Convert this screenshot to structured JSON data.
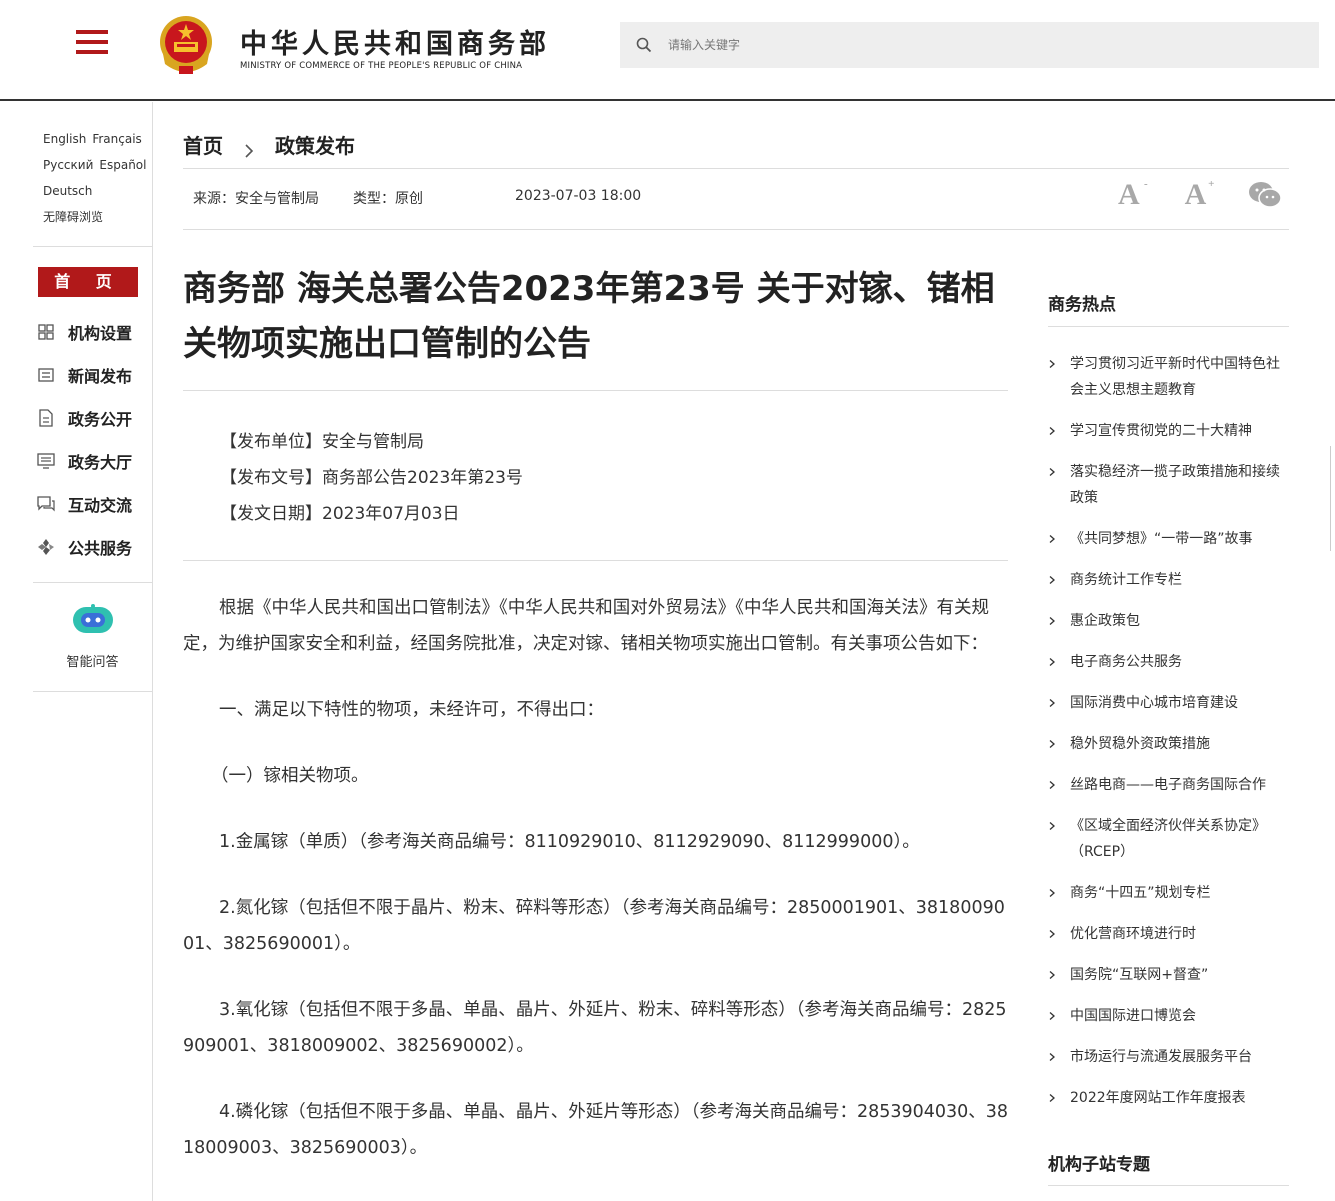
{
  "header": {
    "title": "中华人民共和国商务部",
    "subtitle": "MINISTRY OF COMMERCE OF THE PEOPLE'S REPUBLIC OF CHINA",
    "search_placeholder": "请输入关键字",
    "accent_color": "#b1191a"
  },
  "sidebar": {
    "languages": [
      [
        "English",
        "Français"
      ],
      [
        "Русский",
        "Español"
      ],
      [
        "Deutsch"
      ],
      [
        "无障碍浏览"
      ]
    ],
    "home_label": "首 页",
    "items": [
      {
        "label": "机构设置",
        "icon": "grid-icon"
      },
      {
        "label": "新闻发布",
        "icon": "news-icon"
      },
      {
        "label": "政务公开",
        "icon": "document-icon"
      },
      {
        "label": "政务大厅",
        "icon": "monitor-icon"
      },
      {
        "label": "互动交流",
        "icon": "chat-icon"
      },
      {
        "label": "公共服务",
        "icon": "service-icon"
      }
    ],
    "qa_label": "智能问答"
  },
  "breadcrumb": {
    "home": "首页",
    "current": "政策发布"
  },
  "meta": {
    "source": "来源：安全与管制局",
    "type": "类型：原创",
    "date": "2023-07-03 18:00"
  },
  "article": {
    "title": "商务部 海关总署公告2023年第23号 关于对镓、锗相关物项实施出口管制的公告",
    "issuer": "【发布单位】安全与管制局",
    "doc_no": "【发布文号】商务部公告2023年第23号",
    "doc_date": "【发文日期】2023年07月03日",
    "paragraphs": [
      "根据《中华人民共和国出口管制法》《中华人民共和国对外贸易法》《中华人民共和国海关法》有关规定，为维护国家安全和利益，经国务院批准，决定对镓、锗相关物项实施出口管制。有关事项公告如下：",
      "一、满足以下特性的物项，未经许可，不得出口：",
      "（一）镓相关物项。",
      "1.金属镓（单质）（参考海关商品编号：8110929010、8112929090、8112999000）。",
      "2.氮化镓（包括但不限于晶片、粉末、碎料等形态）（参考海关商品编号：2850001901、3818009001、3825690001）。",
      "3.氧化镓（包括但不限于多晶、单晶、晶片、外延片、粉末、碎料等形态）（参考海关商品编号：2825909001、3818009002、3825690002）。",
      "4.磷化镓（包括但不限于多晶、单晶、晶片、外延片等形态）（参考海关商品编号：2853904030、3818009003、3825690003）。"
    ]
  },
  "right": {
    "hot_title": "商务热点",
    "hot_items": [
      "学习贯彻习近平新时代中国特色社会主义思想主题教育",
      "学习宣传贯彻党的二十大精神",
      "落实稳经济一揽子政策措施和接续政策",
      "《共同梦想》“一带一路”故事",
      "商务统计工作专栏",
      "惠企政策包",
      "电子商务公共服务",
      "国际消费中心城市培育建设",
      "稳外贸稳外资政策措施",
      "丝路电商——电子商务国际合作",
      "《区域全面经济伙伴关系协定》（RCEP）",
      "商务“十四五”规划专栏",
      "优化营商环境进行时",
      "国务院“互联网+督查”",
      "中国国际进口博览会",
      "市场运行与流通发展服务平台",
      "2022年度网站工作年度报表"
    ],
    "sub_title": "机构子站专题"
  }
}
